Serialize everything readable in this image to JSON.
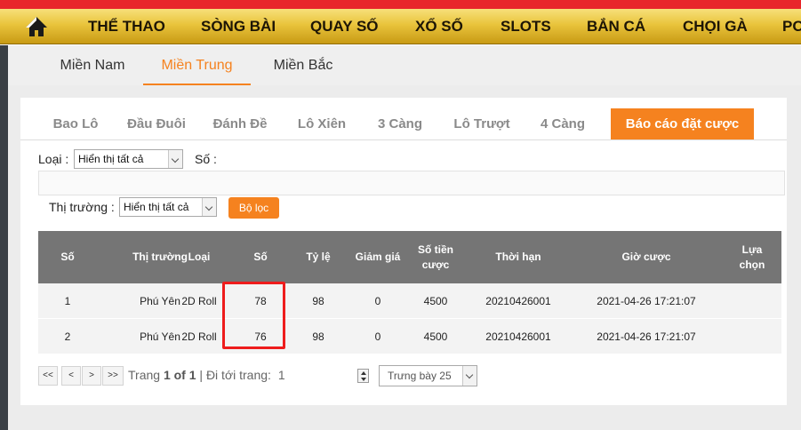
{
  "nav": {
    "home_icon": "home-icon",
    "items": [
      "THỂ THAO",
      "SÒNG BÀI",
      "QUAY SỐ",
      "XỔ SỐ",
      "SLOTS",
      "BẮN CÁ",
      "CHỌI GÀ",
      "PO"
    ]
  },
  "regions": {
    "tabs": [
      "Miền Nam",
      "Miền Trung",
      "Miền Bắc"
    ],
    "active": "Miền Trung"
  },
  "game_tabs": {
    "items": [
      "Bao Lô",
      "Đầu Đuôi",
      "Đánh Đề",
      "Lô Xiên",
      "3 Càng",
      "Lô Trượt",
      "4 Càng",
      "Báo cáo đặt cược"
    ],
    "active": "Báo cáo đặt cược"
  },
  "filters": {
    "type_label": "Loại :",
    "type_value": "Hiển thị tất cả",
    "number_label": "Số :",
    "market_label": "Thị trường :",
    "market_value": "Hiển thị tất cả",
    "filter_button": "Bộ lọc"
  },
  "table": {
    "headers": [
      "Số",
      "Thị trường",
      "Loại",
      "Số",
      "Tỷ lệ",
      "Giảm giá",
      "Số tiền cược",
      "Thời hạn",
      "Giờ cược",
      "Lựa chọn"
    ],
    "rows": [
      [
        "1",
        "Phú Yên",
        "2D Roll",
        "78",
        "98",
        "0",
        "4500",
        "20210426001",
        "2021-04-26 17:21:07",
        ""
      ],
      [
        "2",
        "Phú Yên",
        "2D Roll",
        "76",
        "98",
        "0",
        "4500",
        "20210426001",
        "2021-04-26 17:21:07",
        ""
      ]
    ]
  },
  "pagination": {
    "first": "<<",
    "prev": "<",
    "next": ">",
    "last": ">>",
    "page_prefix": "Trang",
    "page_current": "1 of 1",
    "goto_label": "| Đi tới trang:",
    "goto_value": "1",
    "page_size": "Trưng bày 25"
  },
  "colors": {
    "accent": "#f5821f",
    "nav_gold": "#e9c43c",
    "top_red": "#e8262b",
    "header_gray": "#757575",
    "highlight_red": "#ee1c1c"
  }
}
